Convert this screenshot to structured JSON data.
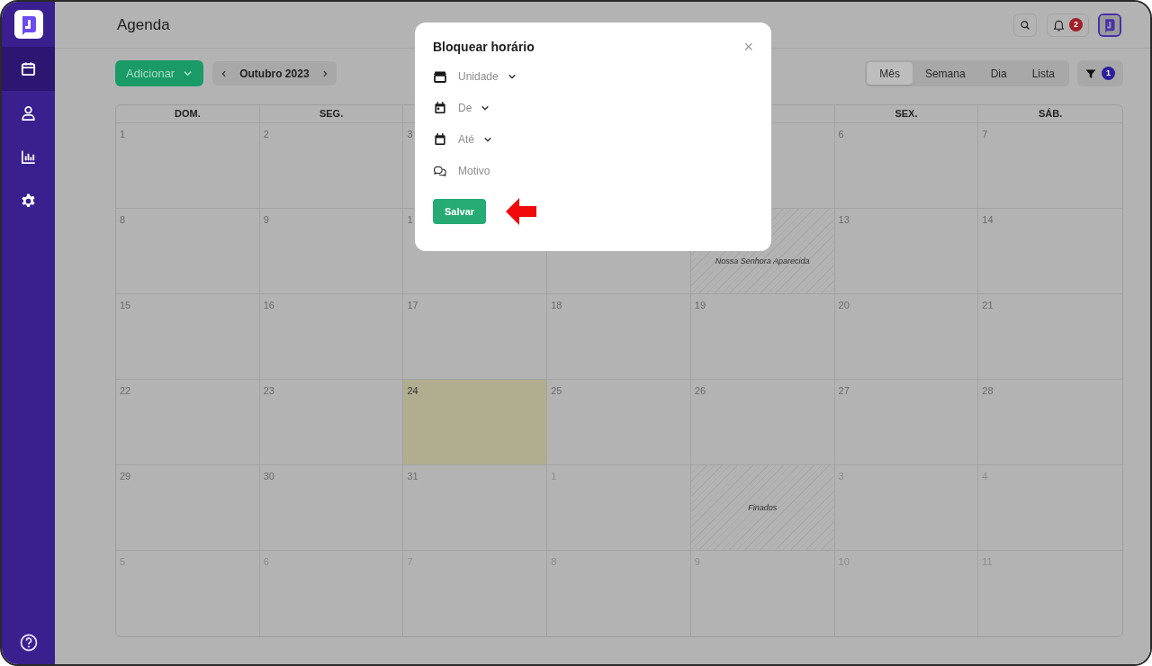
{
  "sidebar": {
    "items": [
      {
        "kind": "calendar",
        "selected": true
      },
      {
        "kind": "person",
        "selected": false
      },
      {
        "kind": "chart",
        "selected": false
      },
      {
        "kind": "settings",
        "selected": false
      }
    ]
  },
  "header": {
    "title": "Agenda",
    "notifications_badge": "2"
  },
  "toolbar": {
    "add_button": "Adicionar",
    "month": "Outubro 2023",
    "views": [
      {
        "label": "Mês",
        "selected": true
      },
      {
        "label": "Semana",
        "selected": false
      },
      {
        "label": "Dia",
        "selected": false
      },
      {
        "label": "Lista",
        "selected": false
      }
    ],
    "filter_badge": "1"
  },
  "calendar": {
    "weekday_headers": {
      "start": [
        "DOM.",
        "SEG."
      ],
      "end": [
        "SEX.",
        "SÁB."
      ]
    },
    "weeks": [
      {
        "start": [
          {
            "number": "1",
            "in_month": true,
            "today": false
          },
          {
            "number": "2",
            "in_month": true,
            "today": false
          },
          {
            "number": "3",
            "in_month": true,
            "today": false
          }
        ],
        "end": [
          {
            "today": false
          },
          {
            "number": "6",
            "in_month": true,
            "today": false
          },
          {
            "number": "7",
            "in_month": true,
            "today": false
          }
        ]
      },
      [
        {
          "number": "8",
          "in_month": true,
          "today": false
        },
        {
          "number": "9",
          "in_month": true,
          "today": false
        },
        {
          "number": "1",
          "in_month": true,
          "today": false
        },
        {
          "today": false
        },
        {
          "today": false,
          "holiday": "Nossa Senhora Aparecida"
        },
        {
          "number": "13",
          "in_month": true,
          "today": false
        },
        {
          "number": "14",
          "in_month": true,
          "today": false
        }
      ],
      [
        {
          "number": "15",
          "in_month": true,
          "today": false
        },
        {
          "number": "16",
          "in_month": true,
          "today": false
        },
        {
          "number": "17",
          "in_month": true,
          "today": false
        },
        {
          "number": "18",
          "in_month": true,
          "today": false
        },
        {
          "number": "19",
          "in_month": true,
          "today": false
        },
        {
          "number": "20",
          "in_month": true,
          "today": false
        },
        {
          "number": "21",
          "in_month": true,
          "today": false
        }
      ],
      [
        {
          "number": "22",
          "in_month": true,
          "today": false
        },
        {
          "number": "23",
          "in_month": true,
          "today": false
        },
        {
          "number": "24",
          "in_month": true,
          "today": true
        },
        {
          "number": "25",
          "in_month": true,
          "today": false
        },
        {
          "number": "26",
          "in_month": true,
          "today": false
        },
        {
          "number": "27",
          "in_month": true,
          "today": false
        },
        {
          "number": "28",
          "in_month": true,
          "today": false
        }
      ],
      [
        {
          "number": "29",
          "in_month": true,
          "today": false
        },
        {
          "number": "30",
          "in_month": true,
          "today": false
        },
        {
          "number": "31",
          "in_month": true,
          "today": false
        },
        {
          "number": "1",
          "in_month": false,
          "today": false
        },
        {
          "today": false,
          "holiday": "Finados"
        },
        {
          "number": "3",
          "in_month": false,
          "today": false
        },
        {
          "number": "4",
          "in_month": false,
          "today": false
        }
      ],
      [
        {
          "number": "5",
          "in_month": false,
          "today": false
        },
        {
          "number": "6",
          "in_month": false,
          "today": false
        },
        {
          "number": "7",
          "in_month": false,
          "today": false
        },
        {
          "number": "8",
          "in_month": false,
          "today": false
        },
        {
          "number": "9",
          "in_month": false,
          "today": false
        },
        {
          "number": "10",
          "in_month": false,
          "today": false
        },
        {
          "number": "11",
          "in_month": false,
          "today": false
        }
      ]
    ]
  },
  "modal": {
    "title": "Bloquear horário",
    "close": "×",
    "fields": [
      {
        "kind": "store",
        "placeholder": "Unidade",
        "dropdown": true
      },
      {
        "kind": "calendar_day",
        "placeholder": "De",
        "dropdown": true
      },
      {
        "kind": "calendar",
        "placeholder": "Até",
        "dropdown": true
      },
      {
        "kind": "chat",
        "placeholder": "Motivo",
        "dropdown": false
      }
    ],
    "save_button": "Salvar"
  }
}
